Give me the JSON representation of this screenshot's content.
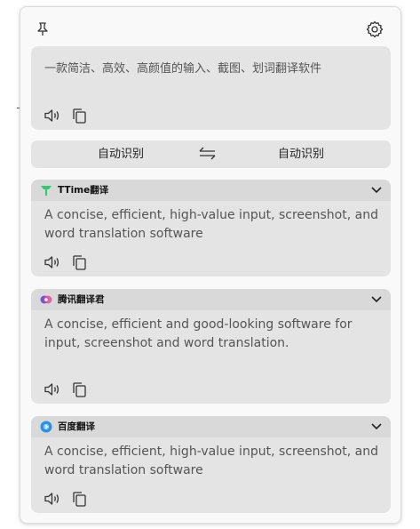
{
  "toolbar": {
    "pin_icon": "pin-icon",
    "settings_icon": "gear-icon"
  },
  "source": {
    "text": "一款简洁、高效、高颜值的输入、截图、划词翻译软件"
  },
  "languages": {
    "from": "自动识别",
    "to": "自动识别",
    "swap_icon": "swap-arrows-icon"
  },
  "results": [
    {
      "service": "TTime翻译",
      "logo_color": "#2ecc71",
      "text": "A concise, efficient, high-value input, screenshot, and word translation software"
    },
    {
      "service": "腾讯翻译君",
      "logo_color": "#7b4fd6",
      "text": "A concise, efficient and good-looking software for input, screenshot and word translation."
    },
    {
      "service": "百度翻译",
      "logo_color": "#2f8fe6",
      "text": "A concise, efficient, high-value input, screenshot, and word translation software"
    }
  ],
  "colors": {
    "panel_bg": "#e4e4e4",
    "header_bg": "#d9d9d9",
    "text": "#555555"
  }
}
